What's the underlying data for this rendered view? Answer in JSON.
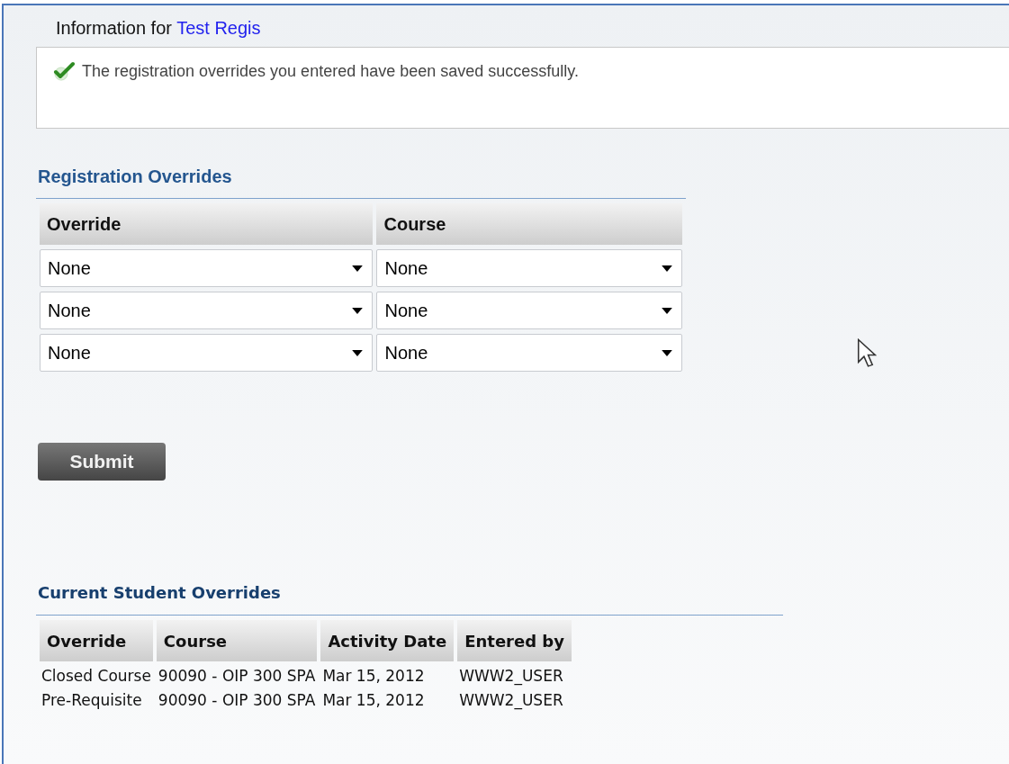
{
  "header": {
    "label": "Information for",
    "student_link": "Test Regis"
  },
  "message": {
    "text": "The registration overrides you entered have been saved successfully."
  },
  "registration_overrides": {
    "title": "Registration Overrides",
    "columns": [
      "Override",
      "Course"
    ],
    "rows": [
      {
        "override": "None",
        "course": "None"
      },
      {
        "override": "None",
        "course": "None"
      },
      {
        "override": "None",
        "course": "None"
      }
    ]
  },
  "submit_button": "Submit",
  "current_overrides": {
    "title": "Current Student Overrides",
    "columns": [
      "Override",
      "Course",
      "Activity Date",
      "Entered by"
    ],
    "rows": [
      [
        "Closed Course",
        "90090 - OIP 300 SPA",
        "Mar 15, 2012",
        "WWW2_USER"
      ],
      [
        "Pre-Requisite",
        "90090 - OIP 300 SPA",
        "Mar 15, 2012",
        "WWW2_USER"
      ]
    ]
  }
}
